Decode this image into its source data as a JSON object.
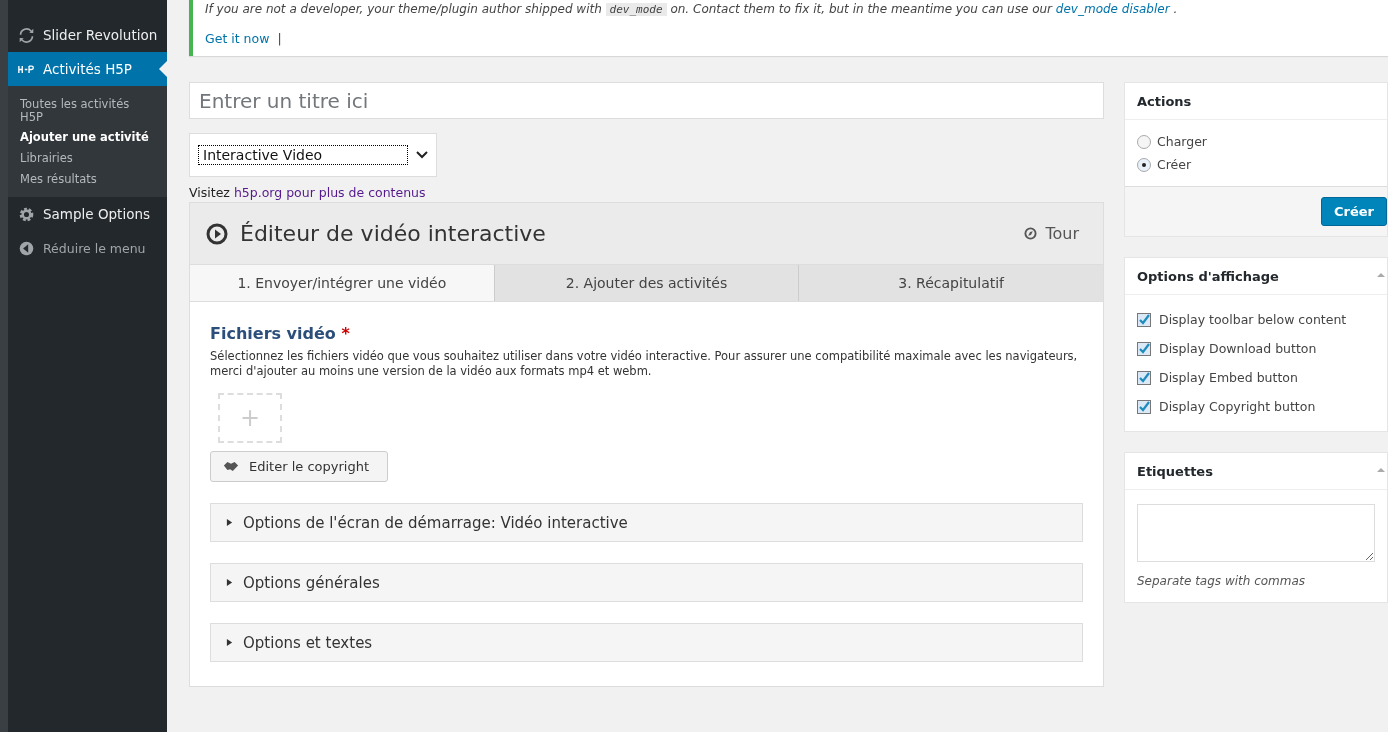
{
  "sidebar": {
    "items": [
      {
        "label": "Slider Revolution",
        "kind": "menu",
        "selected": false
      },
      {
        "label": "Activités H5P",
        "kind": "menu",
        "selected": true,
        "children": [
          {
            "label": "Toutes les activités H5P",
            "selected": false
          },
          {
            "label": "Ajouter une activité",
            "selected": true
          },
          {
            "label": "Librairies",
            "selected": false
          },
          {
            "label": "Mes résultats",
            "selected": false
          }
        ]
      },
      {
        "label": "Sample Options",
        "kind": "menu",
        "selected": false
      },
      {
        "label": "Réduire le menu",
        "kind": "collapse",
        "selected": false
      }
    ]
  },
  "notice": {
    "parts": [
      {
        "kind": "text",
        "text": "If you are not a developer, your theme/plugin author shipped with"
      },
      {
        "kind": "code",
        "text": "dev_mode"
      },
      {
        "kind": "text",
        "text": "on. Contact them to fix it, but in the meantime you can use our"
      },
      {
        "kind": "link",
        "text": "dev_mode disabler"
      },
      {
        "kind": "text",
        "text": "."
      }
    ],
    "link": "Get it now",
    "separator": "|"
  },
  "title_field": {
    "placeholder": "Entrer un titre ici"
  },
  "content_type": {
    "value": "Interactive Video"
  },
  "visit": {
    "text": "Visitez",
    "link": "h5p.org pour plus de contenus"
  },
  "editor": {
    "title": "Éditeur de vidéo interactive",
    "tour": "Tour",
    "tabs": [
      {
        "label": "1. Envoyer/intégrer une vidéo",
        "selected": true
      },
      {
        "label": "2. Ajouter des activités",
        "selected": false
      },
      {
        "label": "3. Récapitulatif",
        "selected": false
      }
    ],
    "field_label": "Fichiers vidéo",
    "required": "*",
    "description": "Sélectionnez les fichiers vidéo que vous souhaitez utiliser dans votre vidéo interactive. Pour assurer une compatibilité maximale avec les navigateurs, merci d'ajouter au moins une version de la vidéo aux formats mp4 et webm.",
    "add": "+",
    "copyright_button": "Editer le copyright",
    "sections": [
      {
        "label": "Options de l'écran de démarrage: Vidéo interactive",
        "expanded": false
      },
      {
        "label": "Options générales",
        "expanded": false
      },
      {
        "label": "Options et textes",
        "expanded": false
      }
    ]
  },
  "actions": {
    "title": "Actions",
    "options": [
      {
        "label": "Charger",
        "selected": false
      },
      {
        "label": "Créer",
        "selected": true
      }
    ],
    "button": "Créer"
  },
  "display_options": {
    "title": "Options d'affichage",
    "items": [
      {
        "label": "Display toolbar below content",
        "checked": true
      },
      {
        "label": "Display Download button",
        "checked": true
      },
      {
        "label": "Display Embed button",
        "checked": true
      },
      {
        "label": "Display Copyright button",
        "checked": true
      }
    ]
  },
  "tags": {
    "title": "Etiquettes",
    "hint": "Separate tags with commas"
  }
}
